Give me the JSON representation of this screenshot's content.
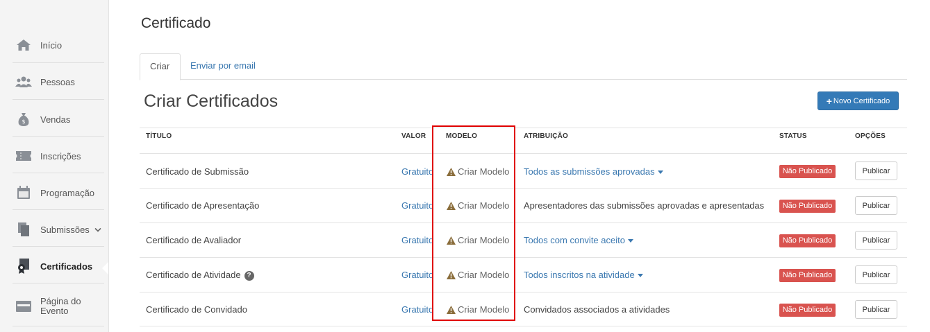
{
  "sidebar": {
    "items": [
      {
        "label": "Início",
        "icon": "home-icon"
      },
      {
        "label": "Pessoas",
        "icon": "people-icon"
      },
      {
        "label": "Vendas",
        "icon": "money-bag-icon"
      },
      {
        "label": "Inscrições",
        "icon": "ticket-icon"
      },
      {
        "label": "Programação",
        "icon": "calendar-icon"
      },
      {
        "label": "Submissões",
        "icon": "documents-icon"
      },
      {
        "label": "Certificados",
        "icon": "certificate-icon"
      },
      {
        "label": "Página do",
        "label2": "Evento",
        "icon": "card-icon"
      }
    ]
  },
  "page": {
    "title": "Certificado",
    "tabs": [
      {
        "label": "Criar"
      },
      {
        "label": "Enviar por email"
      }
    ],
    "section_title": "Criar Certificados",
    "new_button": "Novo Certificado"
  },
  "table": {
    "headers": {
      "titulo": "TÍTULO",
      "valor": "VALOR",
      "modelo": "MODELO",
      "atribuicao": "ATRIBUIÇÃO",
      "status": "STATUS",
      "opcoes": "OPÇÕES"
    },
    "rows": [
      {
        "titulo": "Certificado de Submissão",
        "valor": "Gratuito",
        "modelo": "Criar Modelo",
        "atribuicao": "Todos as submissões aprovadas",
        "status": "Não Publicado",
        "acao": "Publicar"
      },
      {
        "titulo": "Certificado de Apresentação",
        "valor": "Gratuito",
        "modelo": "Criar Modelo",
        "atribuicao": "Apresentadores das submissões aprovadas e apresentadas",
        "status": "Não Publicado",
        "acao": "Publicar"
      },
      {
        "titulo": "Certificado de Avaliador",
        "valor": "Gratuito",
        "modelo": "Criar Modelo",
        "atribuicao": "Todos com convite aceito",
        "status": "Não Publicado",
        "acao": "Publicar"
      },
      {
        "titulo": "Certificado de Atividade",
        "valor": "Gratuito",
        "modelo": "Criar Modelo",
        "atribuicao": "Todos inscritos na atividade",
        "status": "Não Publicado",
        "acao": "Publicar"
      },
      {
        "titulo": "Certificado de Convidado",
        "valor": "Gratuito",
        "modelo": "Criar Modelo",
        "atribuicao": "Convidados associados a atividades",
        "status": "Não Publicado",
        "acao": "Publicar"
      }
    ]
  },
  "colors": {
    "accent": "#347ab7",
    "link": "#3a78b0",
    "danger": "#d9534f",
    "highlight": "#e00000"
  }
}
